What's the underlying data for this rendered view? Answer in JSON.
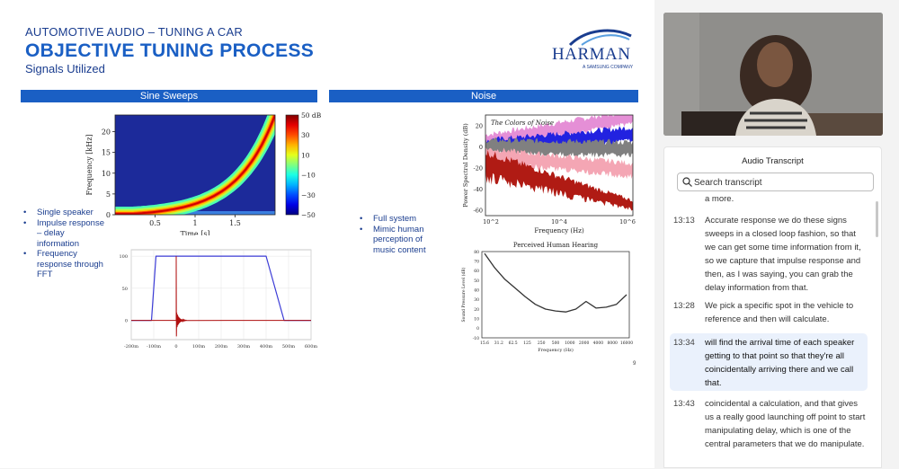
{
  "slide": {
    "kicker": "AUTOMOTIVE AUDIO – TUNING A CAR",
    "title": "OBJECTIVE TUNING PROCESS",
    "subtitle": "Signals Utilized",
    "logo_word": "HARMAN",
    "logo_sub": "A SAMSUNG COMPANY",
    "page_number": "9",
    "sections": {
      "sine": "Sine Sweeps",
      "noise": "Noise"
    },
    "sine_bullets": [
      "Single speaker",
      "Impulse response – delay information",
      "Frequency response through FFT"
    ],
    "noise_bullets": [
      "Full system",
      "Mimic human perception of music content"
    ],
    "colors": {
      "brand_blue": "#1a5fc4",
      "navy": "#1a3d8f"
    }
  },
  "chart_data": [
    {
      "type": "heatmap",
      "title": "",
      "xlabel": "Time [s]",
      "ylabel": "Frequency [kHz]",
      "xticks": [
        "0.5",
        "1",
        "1.5"
      ],
      "yticks": [
        "0",
        "5",
        "10",
        "15",
        "20"
      ],
      "xlim": [
        0,
        2.0
      ],
      "ylim": [
        0,
        24
      ],
      "colorbar_ticks": [
        "50 dB",
        "30",
        "10",
        "−10",
        "−30",
        "−50"
      ],
      "colorbar_range": [
        -50,
        50
      ],
      "sweep": {
        "start_khz": 0,
        "end_khz": 24,
        "start_s": 0,
        "end_s": 2.0,
        "shape": "exponential"
      }
    },
    {
      "type": "line",
      "title": "",
      "xticks": [
        "-200m",
        "-100m",
        "0",
        "100m",
        "200m",
        "300m",
        "400m",
        "500m",
        "600m"
      ],
      "yticks": [
        "100",
        "50",
        "0"
      ],
      "xlim": [
        -0.2,
        0.6
      ],
      "ylim": [
        -30,
        110
      ],
      "series": [
        {
          "color": "#3b3bd6",
          "x": [
            -0.2,
            -0.11,
            -0.09,
            0.4,
            0.48,
            0.6
          ],
          "y": [
            0,
            0,
            100,
            100,
            0,
            0
          ]
        },
        {
          "color": "#b01010",
          "x": [
            -0.2,
            0,
            0.001,
            0.01,
            0.02,
            0.05,
            0.6
          ],
          "y": [
            0,
            100,
            -25,
            8,
            -4,
            0,
            0
          ]
        }
      ]
    },
    {
      "type": "area",
      "title": "The Colors of Noise",
      "xlabel": "Frequency (Hz)",
      "ylabel": "Power Spectral Density (dB)",
      "xticks": [
        "10^2",
        "10^4",
        "10^6"
      ],
      "yticks": [
        "20",
        "0",
        "-20",
        "-40",
        "-60"
      ],
      "ylim": [
        -65,
        30
      ],
      "series": [
        {
          "color": "#e58fd6",
          "start_db": 5,
          "end_db": 28
        },
        {
          "color": "#2222e0",
          "start_db": 0,
          "end_db": 12
        },
        {
          "color": "#808080",
          "start_db": 0,
          "end_db": -2
        },
        {
          "color": "#f4a6b4",
          "start_db": -8,
          "end_db": -22
        },
        {
          "color": "#b01b14",
          "start_db": -15,
          "end_db": -55
        }
      ]
    },
    {
      "type": "line",
      "title": "Perceived Human Hearing",
      "xlabel": "Frequency (Hz)",
      "ylabel": "Sound Pressure Level (dB)",
      "categories": [
        "15.6",
        "31.2",
        "62.5",
        "125",
        "250",
        "500",
        "1000",
        "2000",
        "4000",
        "8000",
        "16000"
      ],
      "yticks": [
        "80",
        "70",
        "60",
        "50",
        "40",
        "30",
        "20",
        "10",
        "0",
        "-10"
      ],
      "ylim": [
        -10,
        80
      ],
      "series": [
        {
          "values": [
            78,
            63,
            51,
            42,
            33,
            25,
            20,
            18,
            17,
            20,
            28,
            21,
            22,
            25,
            35
          ]
        }
      ]
    }
  ],
  "transcript": {
    "header": "Audio Transcript",
    "search_placeholder": "Search transcript",
    "entries": [
      {
        "time": "",
        "text": "a more."
      },
      {
        "time": "13:13",
        "text": "Accurate response we do these signs sweeps in a closed loop fashion, so that we can get some time information from it, so we capture that impulse response and then, as I was saying, you can grab the delay information from that."
      },
      {
        "time": "13:28",
        "text": "We pick a specific spot in the vehicle to reference and then will calculate."
      },
      {
        "time": "13:34",
        "text": "will find the arrival time of each speaker getting to that point so that they're all coincidentally arriving there and we call that."
      },
      {
        "time": "13:43",
        "text": "coincidental a calculation, and that gives us a really good launching off point to start manipulating delay, which is one of the central parameters that we do manipulate."
      }
    ]
  }
}
